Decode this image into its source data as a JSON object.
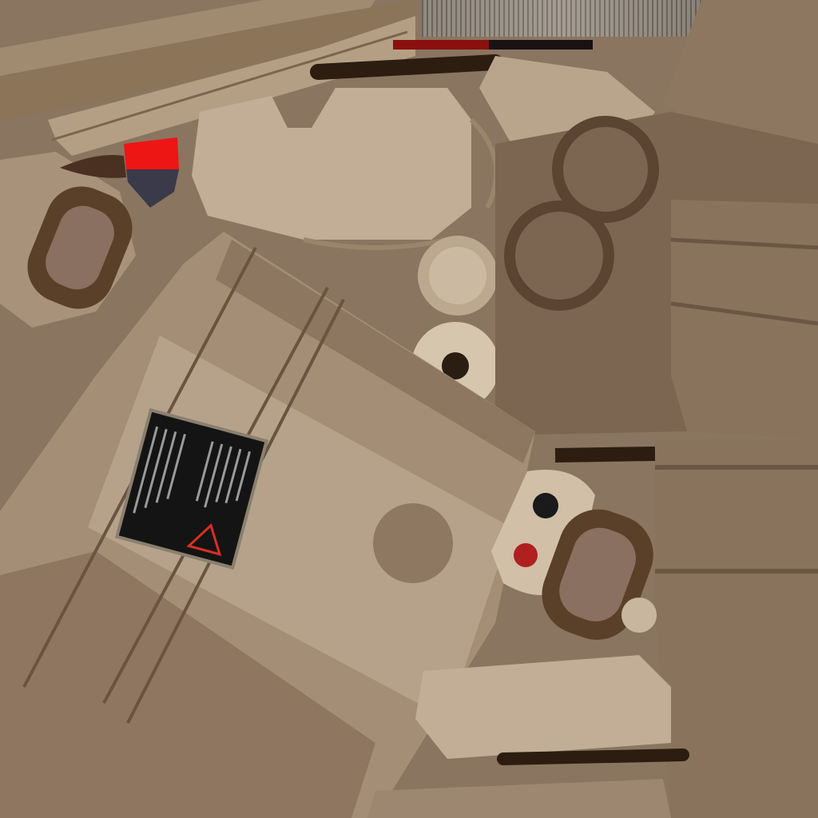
{
  "texture": {
    "palette": {
      "base": "#8a7560",
      "tan_light": "#b8a48b",
      "tan_mid": "#a08a70",
      "tan_dark": "#7a6550",
      "brown_dark": "#5a4028",
      "stroke_dark": "#2c1d10",
      "warning_plate": "#141414",
      "warning_red": "#d9301f",
      "accent_red": "#ee1515",
      "accent_navy": "#3a3a4a",
      "red_dot": "#b02020",
      "black_dot": "#1a1a1a"
    },
    "warning_plate": {
      "icon": "warning-triangle-icon",
      "lines_unreadable": true
    },
    "icons": [
      "ring-icon",
      "button-dot-icon",
      "grip-icon",
      "fin-icon"
    ]
  }
}
